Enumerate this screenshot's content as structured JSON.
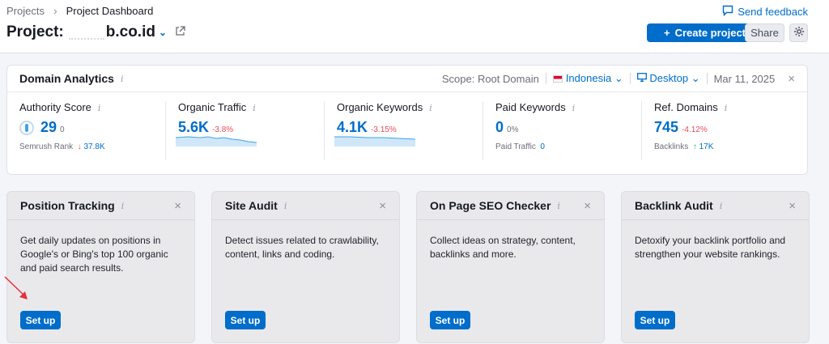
{
  "breadcrumb": {
    "root": "Projects",
    "current": "Project Dashboard"
  },
  "project": {
    "prefix": "Project:",
    "domain": "b.co.id"
  },
  "header": {
    "feedback": "Send feedback",
    "create": "Create project",
    "share": "Share"
  },
  "analytics": {
    "title": "Domain Analytics",
    "scope": "Scope: Root Domain",
    "country": "Indonesia",
    "device": "Desktop",
    "date": "Mar 11, 2025",
    "metrics": [
      {
        "label": "Authority Score",
        "value": "29",
        "extra": "0",
        "sub_label": "Semrush Rank",
        "sub_value": "37.8K",
        "sub_dir": "↓"
      },
      {
        "label": "Organic Traffic",
        "value": "5.6K",
        "change": "-3.8%"
      },
      {
        "label": "Organic Keywords",
        "value": "4.1K",
        "change": "-3.15%"
      },
      {
        "label": "Paid Keywords",
        "value": "0",
        "extra": "0%",
        "sub_label": "Paid Traffic",
        "sub_value": "0"
      },
      {
        "label": "Ref. Domains",
        "value": "745",
        "change": "-4.12%",
        "sub_label": "Backlinks",
        "sub_value": "17K",
        "sub_dir": "↑"
      }
    ]
  },
  "cards": [
    {
      "title": "Position Tracking",
      "body": "Get daily updates on positions in Google's or Bing's top 100 organic and paid search results.",
      "button": "Set up"
    },
    {
      "title": "Site Audit",
      "body": "Detect issues related to crawlability, content, links and coding.",
      "button": "Set up"
    },
    {
      "title": "On Page SEO Checker",
      "body": "Collect ideas on strategy, content, backlinks and more.",
      "button": "Set up"
    },
    {
      "title": "Backlink Audit",
      "body": "Detoxify your backlink portfolio and strengthen your website rankings.",
      "button": "Set up"
    }
  ],
  "colors": {
    "accent": "#006dca",
    "negative": "#e84c5a",
    "positive": "#2fae52",
    "annotation": "#e8303a"
  }
}
